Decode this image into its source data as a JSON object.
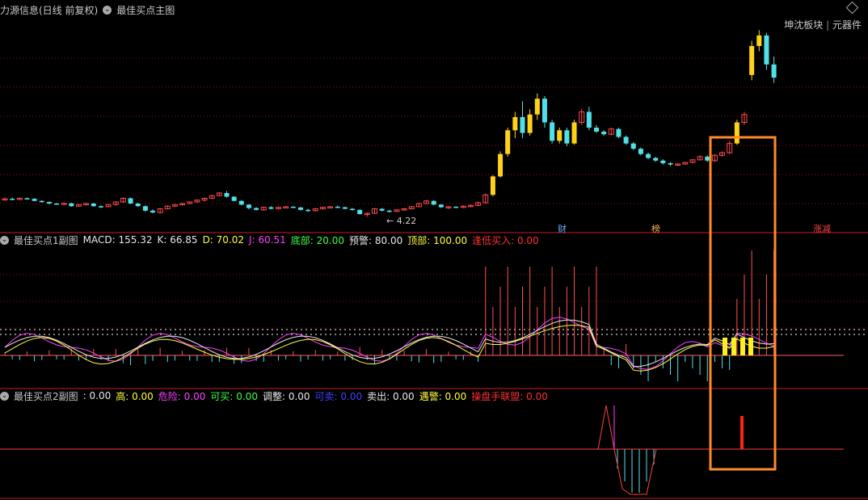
{
  "main": {
    "title": "力源信息(日线 前复权)",
    "indicator": "最佳买点主图",
    "top_right_a": "坤沈板块",
    "top_right_b": "元器件",
    "low_label": "← 4.22",
    "markers": [
      "财",
      "榜",
      "涨减"
    ]
  },
  "sub1": {
    "name": "最佳买点1副图",
    "items": [
      {
        "label": "MACD: ",
        "value": "155.32",
        "color": "#e8e8e8"
      },
      {
        "label": "K: ",
        "value": "66.85",
        "color": "#e8e8e8"
      },
      {
        "label": "D: ",
        "value": "70.02",
        "color": "#ffff40"
      },
      {
        "label": "J: ",
        "value": "60.51",
        "color": "#ff40ff"
      },
      {
        "label": "底部: ",
        "value": "20.00",
        "color": "#40ff40"
      },
      {
        "label": "预警: ",
        "value": "80.00",
        "color": "#e8e8e8"
      },
      {
        "label": "顶部: ",
        "value": "100.00",
        "color": "#ffff40"
      },
      {
        "label": "逢低买入: ",
        "value": "0.00",
        "color": "#ff3030"
      }
    ]
  },
  "sub2": {
    "name": "最佳买点2副图",
    "items": [
      {
        "label": ": ",
        "value": "0.00",
        "color": "#e8e8e8"
      },
      {
        "label": "高: ",
        "value": "0.00",
        "color": "#ffff40"
      },
      {
        "label": "危险: ",
        "value": "0.00",
        "color": "#ff40ff"
      },
      {
        "label": "可买: ",
        "value": "0.00",
        "color": "#40ff40"
      },
      {
        "label": "调整: ",
        "value": "0.00",
        "color": "#e8e8e8"
      },
      {
        "label": "可卖: ",
        "value": "0.00",
        "color": "#4040ff"
      },
      {
        "label": "卖出: ",
        "value": "0.00",
        "color": "#e8e8e8"
      },
      {
        "label": "遇警: ",
        "value": "0.00",
        "color": "#ffff40"
      },
      {
        "label": "操盘手联盟: ",
        "value": "0.00",
        "color": "#ff3030"
      }
    ]
  },
  "chart_data": {
    "type": "candlestick",
    "candles": [
      [
        4.9,
        4.95,
        4.85,
        4.9
      ],
      [
        4.9,
        4.95,
        4.85,
        4.88
      ],
      [
        4.88,
        4.95,
        4.85,
        4.92
      ],
      [
        4.92,
        4.95,
        4.9,
        4.9
      ],
      [
        4.9,
        4.92,
        4.8,
        4.82
      ],
      [
        4.82,
        4.85,
        4.75,
        4.78
      ],
      [
        4.78,
        4.8,
        4.7,
        4.72
      ],
      [
        4.72,
        4.75,
        4.68,
        4.7
      ],
      [
        4.7,
        4.75,
        4.68,
        4.73
      ],
      [
        4.73,
        4.75,
        4.6,
        4.62
      ],
      [
        4.62,
        4.7,
        4.6,
        4.68
      ],
      [
        4.68,
        4.75,
        4.65,
        4.72
      ],
      [
        4.72,
        4.75,
        4.6,
        4.62
      ],
      [
        4.62,
        4.65,
        4.55,
        4.6
      ],
      [
        4.6,
        4.7,
        4.58,
        4.68
      ],
      [
        4.68,
        4.8,
        4.65,
        4.78
      ],
      [
        4.78,
        4.95,
        4.75,
        4.92
      ],
      [
        4.92,
        4.95,
        4.7,
        4.72
      ],
      [
        4.72,
        4.75,
        4.6,
        4.62
      ],
      [
        4.62,
        4.65,
        4.4,
        4.45
      ],
      [
        4.45,
        4.5,
        4.35,
        4.38
      ],
      [
        4.38,
        4.55,
        4.35,
        4.52
      ],
      [
        4.52,
        4.65,
        4.5,
        4.62
      ],
      [
        4.62,
        4.7,
        4.6,
        4.68
      ],
      [
        4.68,
        4.75,
        4.65,
        4.72
      ],
      [
        4.72,
        4.8,
        4.7,
        4.78
      ],
      [
        4.78,
        4.88,
        4.75,
        4.85
      ],
      [
        4.85,
        4.95,
        4.8,
        4.92
      ],
      [
        4.92,
        5.05,
        4.9,
        5.02
      ],
      [
        5.02,
        5.15,
        5.0,
        5.12
      ],
      [
        5.12,
        5.2,
        4.95,
        4.98
      ],
      [
        4.98,
        5.0,
        4.8,
        4.82
      ],
      [
        4.82,
        4.85,
        4.65,
        4.68
      ],
      [
        4.68,
        4.7,
        4.5,
        4.55
      ],
      [
        4.55,
        4.58,
        4.45,
        4.48
      ],
      [
        4.48,
        4.6,
        4.45,
        4.58
      ],
      [
        4.58,
        4.62,
        4.5,
        4.52
      ],
      [
        4.52,
        4.6,
        4.5,
        4.58
      ],
      [
        4.58,
        4.62,
        4.55,
        4.6
      ],
      [
        4.6,
        4.62,
        4.55,
        4.57
      ],
      [
        4.57,
        4.6,
        4.45,
        4.48
      ],
      [
        4.48,
        4.52,
        4.4,
        4.45
      ],
      [
        4.45,
        4.55,
        4.42,
        4.52
      ],
      [
        4.52,
        4.6,
        4.5,
        4.58
      ],
      [
        4.58,
        4.62,
        4.55,
        4.6
      ],
      [
        4.6,
        4.65,
        4.55,
        4.58
      ],
      [
        4.58,
        4.6,
        4.5,
        4.52
      ],
      [
        4.52,
        4.55,
        4.45,
        4.48
      ],
      [
        4.48,
        4.5,
        4.3,
        4.32
      ],
      [
        4.32,
        4.38,
        4.22,
        4.35
      ],
      [
        4.35,
        4.55,
        4.32,
        4.52
      ],
      [
        4.52,
        4.55,
        4.42,
        4.45
      ],
      [
        4.45,
        4.48,
        4.38,
        4.42
      ],
      [
        4.42,
        4.5,
        4.4,
        4.48
      ],
      [
        4.48,
        4.55,
        4.45,
        4.52
      ],
      [
        4.52,
        4.62,
        4.5,
        4.6
      ],
      [
        4.6,
        4.75,
        4.58,
        4.72
      ],
      [
        4.72,
        4.85,
        4.7,
        4.82
      ],
      [
        4.82,
        4.85,
        4.65,
        4.68
      ],
      [
        4.68,
        4.7,
        4.55,
        4.58
      ],
      [
        4.58,
        4.62,
        4.52,
        4.6
      ],
      [
        4.6,
        4.62,
        4.55,
        4.58
      ],
      [
        4.58,
        4.65,
        4.55,
        4.62
      ],
      [
        4.62,
        4.68,
        4.58,
        4.65
      ],
      [
        4.65,
        4.8,
        4.62,
        4.75
      ],
      [
        4.75,
        5.1,
        4.72,
        5.05
      ],
      [
        5.05,
        5.8,
        5.0,
        5.75
      ],
      [
        5.75,
        6.7,
        5.7,
        6.6
      ],
      [
        6.6,
        7.6,
        6.5,
        7.5
      ],
      [
        7.5,
        8.2,
        7.2,
        8.0
      ],
      [
        8.0,
        8.6,
        7.2,
        7.4
      ],
      [
        7.4,
        8.3,
        7.3,
        8.1
      ],
      [
        8.1,
        8.9,
        7.9,
        8.7
      ],
      [
        8.7,
        8.8,
        7.6,
        7.8
      ],
      [
        7.8,
        7.9,
        7.0,
        7.1
      ],
      [
        7.1,
        7.6,
        7.0,
        7.5
      ],
      [
        7.5,
        7.6,
        6.9,
        7.0
      ],
      [
        7.0,
        7.9,
        6.95,
        7.8
      ],
      [
        7.8,
        8.3,
        7.7,
        8.2
      ],
      [
        8.2,
        8.4,
        7.5,
        7.6
      ],
      [
        7.6,
        7.7,
        7.4,
        7.45
      ],
      [
        7.45,
        7.5,
        7.3,
        7.35
      ],
      [
        7.35,
        7.6,
        7.3,
        7.55
      ],
      [
        7.55,
        7.6,
        7.2,
        7.25
      ],
      [
        7.25,
        7.3,
        6.95,
        7.0
      ],
      [
        7.0,
        7.05,
        6.75,
        6.8
      ],
      [
        6.8,
        6.85,
        6.55,
        6.6
      ],
      [
        6.6,
        6.65,
        6.4,
        6.45
      ],
      [
        6.45,
        6.5,
        6.3,
        6.35
      ],
      [
        6.35,
        6.4,
        6.2,
        6.25
      ],
      [
        6.25,
        6.3,
        6.15,
        6.2
      ],
      [
        6.2,
        6.25,
        6.15,
        6.22
      ],
      [
        6.22,
        6.3,
        6.2,
        6.28
      ],
      [
        6.28,
        6.4,
        6.25,
        6.38
      ],
      [
        6.38,
        6.55,
        6.35,
        6.5
      ],
      [
        6.5,
        6.55,
        6.3,
        6.35
      ],
      [
        6.35,
        6.6,
        6.3,
        6.55
      ],
      [
        6.55,
        6.7,
        6.5,
        6.65
      ],
      [
        6.65,
        7.1,
        6.6,
        7.0
      ],
      [
        7.0,
        7.9,
        6.95,
        7.8
      ],
      [
        7.8,
        8.2,
        7.7,
        8.1
      ],
      [
        9.6,
        10.9,
        9.4,
        10.7
      ],
      [
        10.7,
        11.3,
        10.5,
        11.1
      ],
      [
        11.1,
        11.2,
        9.8,
        10.0
      ],
      [
        10.0,
        10.3,
        9.3,
        9.5
      ]
    ],
    "low_annotation": 4.22
  }
}
